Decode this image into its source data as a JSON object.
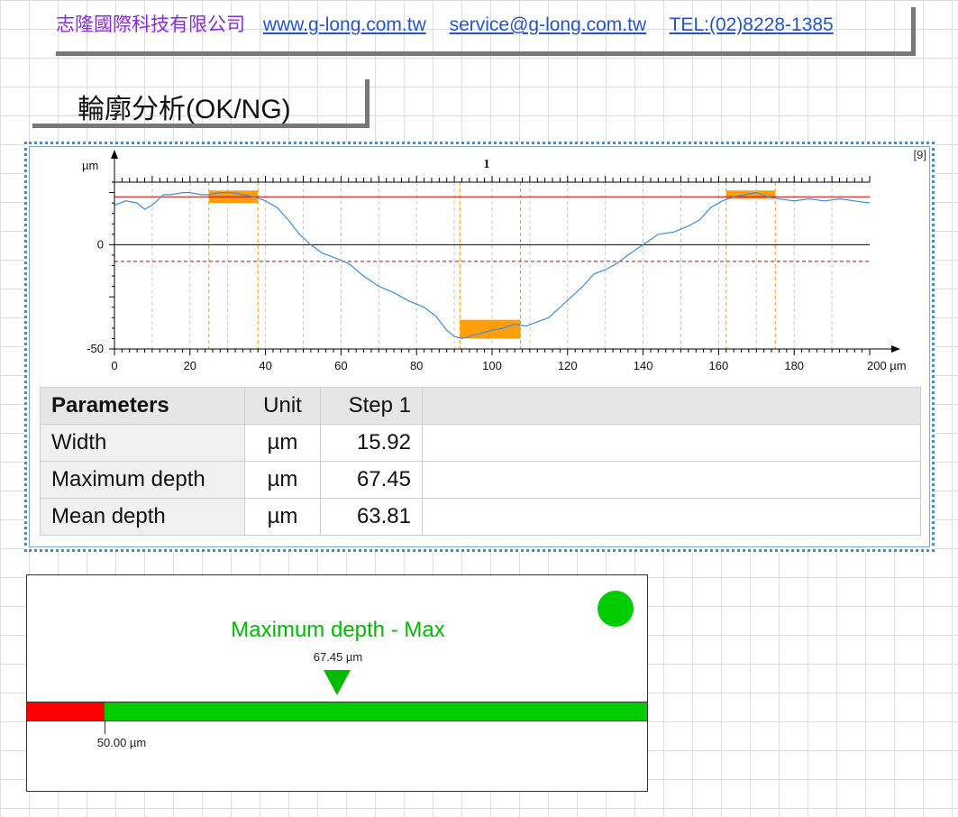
{
  "header": {
    "company": "志隆國際科技有限公司",
    "website": "www.g-long.com.tw",
    "email": "service@g-long.com.tw",
    "phone": "TEL:(02)8228-1385"
  },
  "title": "輪廓分析(OK/NG)",
  "panel": {
    "index_label": "[9]"
  },
  "chart_data": {
    "type": "line",
    "title": "1",
    "y_unit": "µm",
    "x_unit": "µm",
    "xlim": [
      0,
      200
    ],
    "ylim": [
      -50,
      30
    ],
    "x_ticks": [
      0,
      20,
      40,
      60,
      80,
      100,
      120,
      140,
      160,
      180
    ],
    "x_tick_labels": [
      "0",
      "20",
      "40",
      "60",
      "80",
      "100",
      "120",
      "140",
      "160",
      "180",
      "200 µm"
    ],
    "y_ticks": [
      0,
      -50
    ],
    "y_tick_labels": [
      "0",
      "-50"
    ],
    "series": [
      {
        "x": [
          0,
          3,
          6,
          8,
          10,
          13,
          15,
          18,
          20,
          23,
          25,
          28,
          31,
          34,
          37,
          40,
          43,
          46,
          49,
          52,
          55,
          58,
          62,
          66,
          70,
          74,
          78,
          82,
          85,
          88,
          90,
          92,
          94,
          96,
          98,
          100,
          103,
          106,
          109,
          112,
          115,
          118,
          121,
          124,
          127,
          130,
          133,
          136,
          140,
          144,
          148,
          152,
          155,
          158,
          161,
          164,
          167,
          170,
          173,
          176,
          180,
          184,
          188,
          192,
          196,
          200
        ],
        "y": [
          19,
          21,
          20,
          17,
          19,
          24,
          24,
          25,
          25,
          24,
          24,
          25,
          25,
          24,
          23,
          21,
          18,
          12,
          5,
          0,
          -4,
          -6,
          -9,
          -15,
          -20,
          -23,
          -27,
          -30,
          -34,
          -41,
          -44,
          -45,
          -44,
          -43,
          -42,
          -41,
          -40,
          -38,
          -39,
          -37,
          -35,
          -30,
          -25,
          -20,
          -14,
          -12,
          -9,
          -5,
          0,
          5,
          6,
          9,
          12,
          18,
          21,
          23,
          24,
          25,
          23,
          22,
          21,
          22,
          21,
          22,
          21,
          20
        ]
      }
    ],
    "reference_line": 23,
    "lower_limit_line": -8,
    "zero_line": 0,
    "regions": [
      {
        "x": [
          25,
          38
        ],
        "band": [
          20,
          26
        ]
      },
      {
        "x": [
          91.5,
          107.5
        ],
        "band": [
          -45,
          -36
        ]
      },
      {
        "x": [
          162,
          175
        ],
        "band": [
          22,
          26
        ]
      }
    ],
    "grid": true
  },
  "table": {
    "headers": [
      "Parameters",
      "Unit",
      "Step 1"
    ],
    "rows": [
      [
        "Width",
        "µm",
        "15.92"
      ],
      [
        "Maximum depth",
        "µm",
        "67.45"
      ],
      [
        "Mean depth",
        "µm",
        "63.81"
      ]
    ]
  },
  "gauge": {
    "title": "Maximum depth - Max",
    "value_label": "67.45 µm",
    "value": 67.45,
    "limit_label": "50.00 µm",
    "limit": 50,
    "status_color": "#00cc00",
    "fail_color": "#ff0000",
    "pass_color": "#00cc00"
  }
}
